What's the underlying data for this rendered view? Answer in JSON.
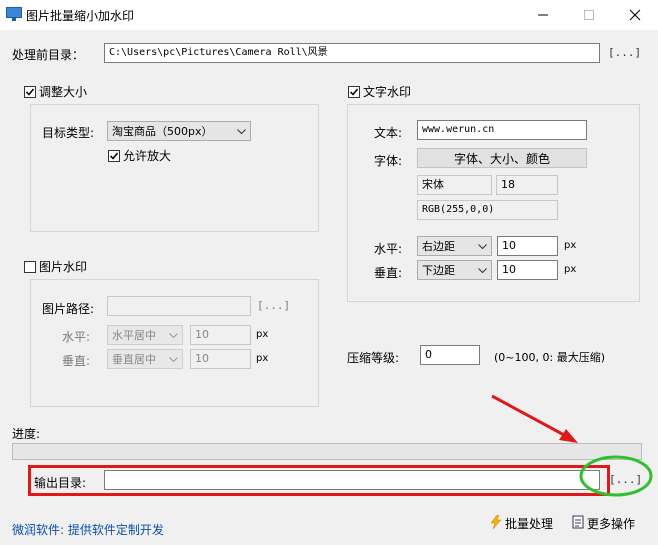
{
  "window": {
    "title": "图片批量缩小加水印"
  },
  "source": {
    "label": "处理前目录：",
    "path": "C:\\Users\\pc\\Pictures\\Camera Roll\\风景",
    "browse_label": "[...]"
  },
  "resize": {
    "enabled_label": "调整大小",
    "target_type_label": "目标类型:",
    "target_type_value": "淘宝商品（500px）",
    "allow_enlarge_label": "允许放大"
  },
  "text_watermark": {
    "enabled_label": "文字水印",
    "text_label": "文本:",
    "text_value": "www.werun.cn",
    "font_label": "字体:",
    "font_button_label": "字体、大小、颜色",
    "font_name": "宋体",
    "font_size": "18",
    "color_value": "RGB(255,0,0)",
    "horizontal_label": "水平:",
    "horizontal_value": "右边距",
    "horizontal_offset": "10",
    "vertical_label": "垂直:",
    "vertical_value": "下边距",
    "vertical_offset": "10",
    "unit": "px"
  },
  "image_watermark": {
    "enabled_label": "图片水印",
    "path_label": "图片路径:",
    "path_value": "",
    "browse_label": "[...]",
    "horizontal_label": "水平:",
    "horizontal_value": "水平居中",
    "horizontal_offset": "10",
    "vertical_label": "垂直:",
    "vertical_value": "垂直居中",
    "vertical_offset": "10",
    "unit": "px"
  },
  "compression": {
    "label": "压缩等级:",
    "value": "0",
    "hint": "(0~100, 0: 最大压缩)"
  },
  "progress": {
    "label": "进度:",
    "value": 0
  },
  "output": {
    "label": "输出目录:",
    "path": "",
    "browse_label": "[...]"
  },
  "footer": {
    "company": "微润软件: 提供软件定制开发",
    "batch_label": "批量处理",
    "more_label": "更多操作"
  },
  "colors": {
    "highlight_box": "#e01818",
    "highlight_circle": "#2ec02e",
    "arrow": "#e01818",
    "link": "#0b4fa8"
  }
}
